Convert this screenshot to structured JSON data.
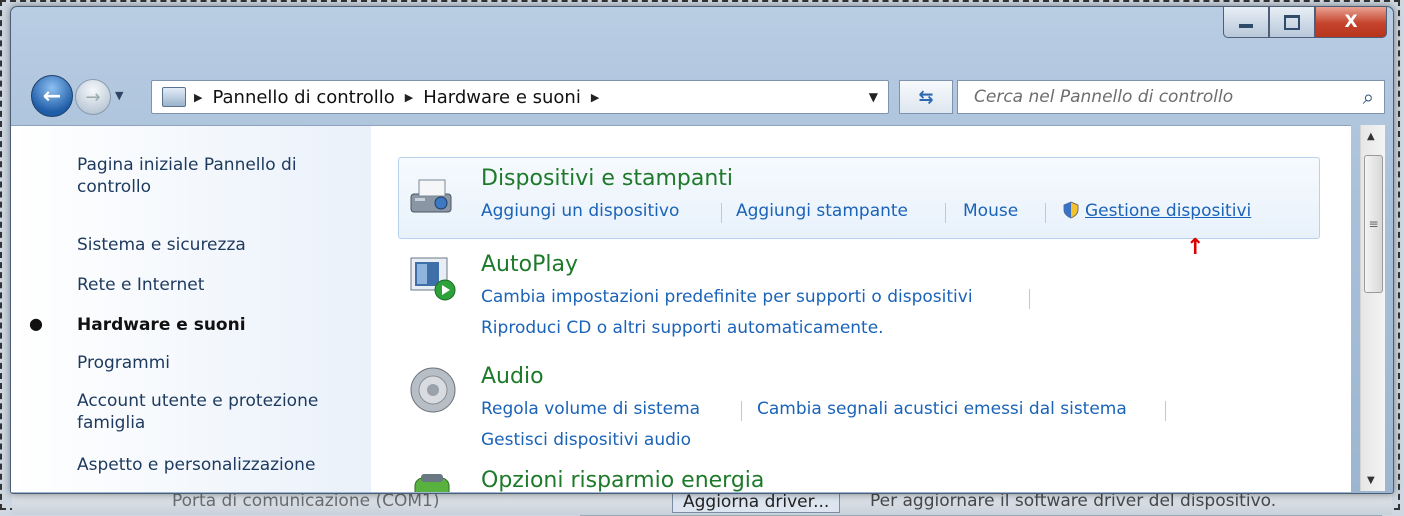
{
  "window": {
    "minimize_glyph": "",
    "maximize_glyph": "",
    "close_glyph": "X"
  },
  "nav": {
    "back_glyph": "←",
    "forward_glyph": "→",
    "breadcrumb": [
      "Pannello di controllo",
      "Hardware e suoni"
    ],
    "search_placeholder": "Cerca nel Pannello di controllo"
  },
  "sidebar": {
    "items": [
      {
        "label": "Pagina iniziale Pannello di controllo",
        "line1": "Pagina iniziale Pannello di",
        "line2": "controllo"
      },
      {
        "label": "Sistema e sicurezza"
      },
      {
        "label": "Rete e Internet"
      },
      {
        "label": "Hardware e suoni",
        "active": true
      },
      {
        "label": "Programmi"
      },
      {
        "label": "Account utente e protezione famiglia",
        "line1": "Account utente e protezione",
        "line2": "famiglia"
      },
      {
        "label": "Aspetto e personalizzazione"
      }
    ]
  },
  "main": {
    "groups": [
      {
        "title": "Dispositivi e stampanti",
        "icon": "printer-camera-icon",
        "links": [
          "Aggiungi un dispositivo",
          "Aggiungi stampante",
          "Mouse",
          "Gestione dispositivi"
        ]
      },
      {
        "title": "AutoPlay",
        "icon": "autoplay-icon",
        "links": [
          "Cambia impostazioni predefinite per supporti o dispositivi",
          "Riproduci CD o altri supporti automaticamente."
        ]
      },
      {
        "title": "Audio",
        "icon": "speaker-icon",
        "links": [
          "Regola volume di sistema",
          "Cambia segnali acustici emessi dal sistema",
          "Gestisci dispositivi audio"
        ]
      },
      {
        "title": "Opzioni risparmio energia",
        "icon": "battery-icon",
        "links": []
      }
    ],
    "annotation_arrow": "↑"
  },
  "background": {
    "bottom_texts": [
      "Porta di comunicazione (COM1)",
      "Aggiorna driver...",
      "Per aggiornare il software driver del dispositivo."
    ]
  },
  "colors": {
    "title_green": "#1e7a2a",
    "link_blue": "#1a63b8",
    "arrow_red": "#dd0000"
  }
}
